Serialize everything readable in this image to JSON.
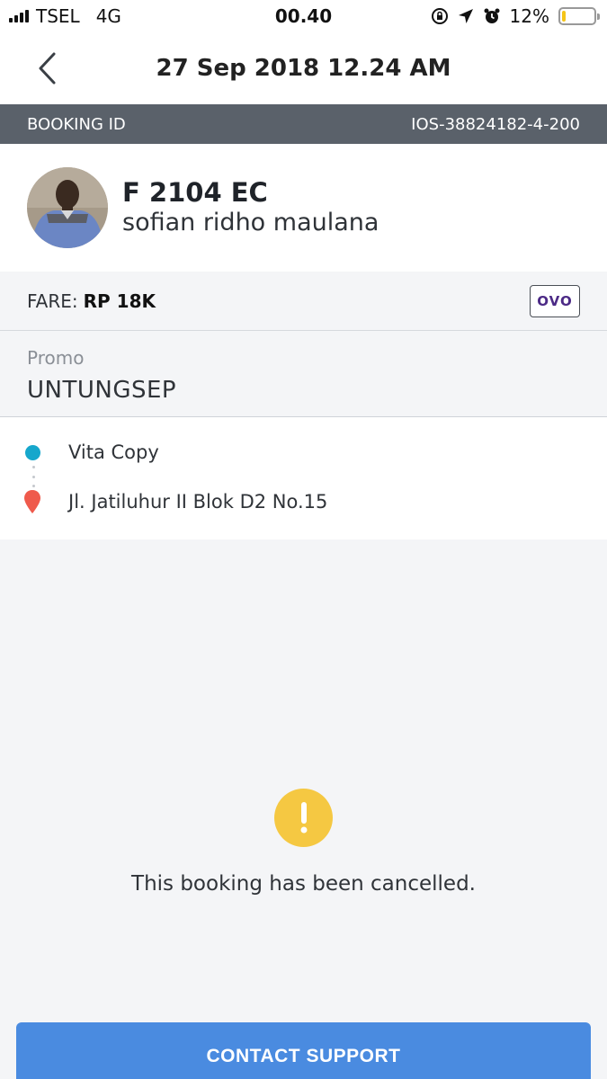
{
  "status_bar": {
    "carrier": "TSEL",
    "network": "4G",
    "time": "00.40",
    "battery_percent": "12%",
    "battery_level": 0.12,
    "battery_color": "#f5c518"
  },
  "nav": {
    "title": "27 Sep 2018 12.24 AM",
    "back_icon": "chevron-left-icon"
  },
  "booking": {
    "label": "BOOKING ID",
    "id": "IOS-38824182-4-200"
  },
  "driver": {
    "plate": "F 2104 EC",
    "name": "sofian ridho maulana"
  },
  "fare": {
    "label": "FARE:",
    "value": "RP 18K",
    "payment_method": "OVO"
  },
  "promo": {
    "label": "Promo",
    "code": "UNTUNGSEP"
  },
  "route": {
    "pickup": "Vita Copy",
    "dropoff": "Jl. Jatiluhur II Blok D2 No.15",
    "pickup_color": "#16a7cc",
    "dropoff_color": "#ef5a4c"
  },
  "status": {
    "message": "This booking has been cancelled.",
    "icon": "exclamation-icon",
    "icon_color": "#f5c842"
  },
  "actions": {
    "contact_support": "CONTACT SUPPORT",
    "button_color": "#4a8be0"
  }
}
